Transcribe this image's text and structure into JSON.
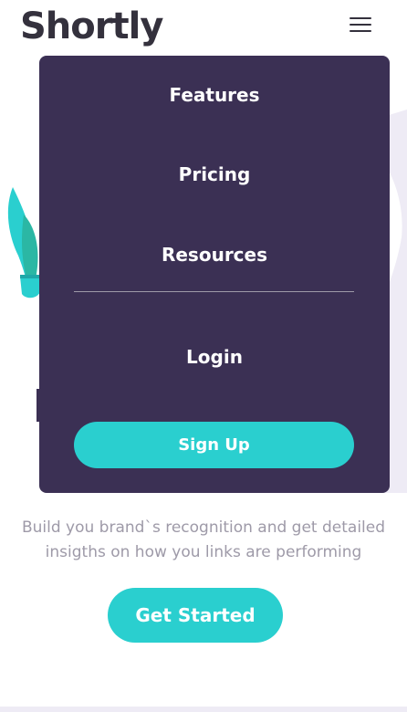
{
  "header": {
    "logo": "Shortly",
    "menu_icon": "hamburger-icon"
  },
  "menu": {
    "items": [
      {
        "label": "Features"
      },
      {
        "label": "Pricing"
      },
      {
        "label": "Resources"
      },
      {
        "label": "Login"
      }
    ],
    "signup_label": "Sign Up"
  },
  "hero": {
    "description_line1": "Build you brand`s recognition and get detailed",
    "description_line2": "insigths on how you links are performing",
    "cta_label": "Get Started"
  },
  "colors": {
    "primary_cyan": "#2acfcf",
    "dark_violet": "#3b3054",
    "grayish_violet": "#9e9aa8",
    "very_dark_blue": "#34313d"
  }
}
